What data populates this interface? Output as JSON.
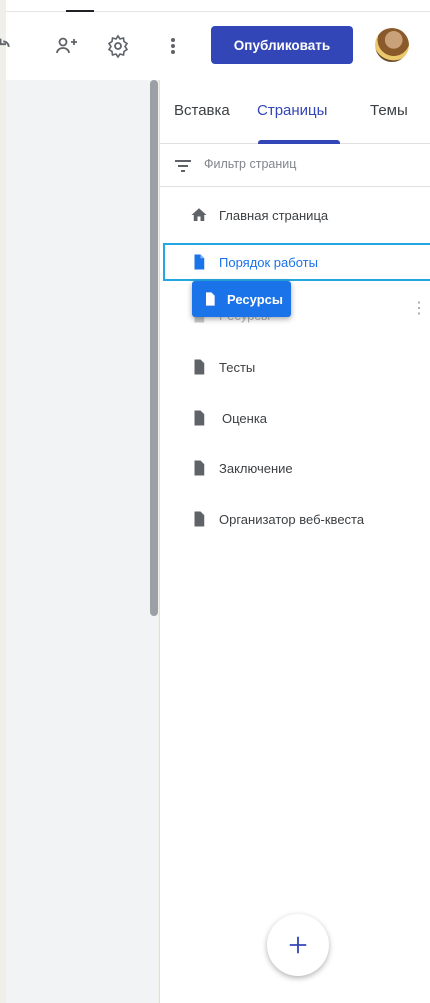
{
  "toolbar": {
    "publish_label": "Опубликовать",
    "icons": [
      "redo-icon",
      "share-icon",
      "settings-icon",
      "more-vert-icon"
    ]
  },
  "panel": {
    "tabs": [
      {
        "label": "Вставка",
        "active": false
      },
      {
        "label": "Страницы",
        "active": true
      },
      {
        "label": "Темы",
        "active": false
      }
    ],
    "filter_placeholder": "Фильтр страниц",
    "pages": [
      {
        "label": "Главная страница",
        "icon": "home-icon",
        "state": "normal"
      },
      {
        "label": "Порядок работы",
        "icon": "page-icon",
        "state": "selected"
      },
      {
        "label": "Ресурсы",
        "icon": "page-icon",
        "state": "ghost"
      },
      {
        "label": "Тесты",
        "icon": "page-icon",
        "state": "normal"
      },
      {
        "label": "Оценка",
        "icon": "page-icon",
        "state": "normal"
      },
      {
        "label": "Заключение",
        "icon": "page-icon",
        "state": "normal"
      },
      {
        "label": "Организатор веб-квеста",
        "icon": "page-icon",
        "state": "normal"
      }
    ],
    "dragging_label": "Ресурсы"
  },
  "colors": {
    "accent": "#3346b7",
    "selected_text": "#1a73e8",
    "selected_border": "#24a7e0",
    "drag_chip": "#1a73e8"
  }
}
